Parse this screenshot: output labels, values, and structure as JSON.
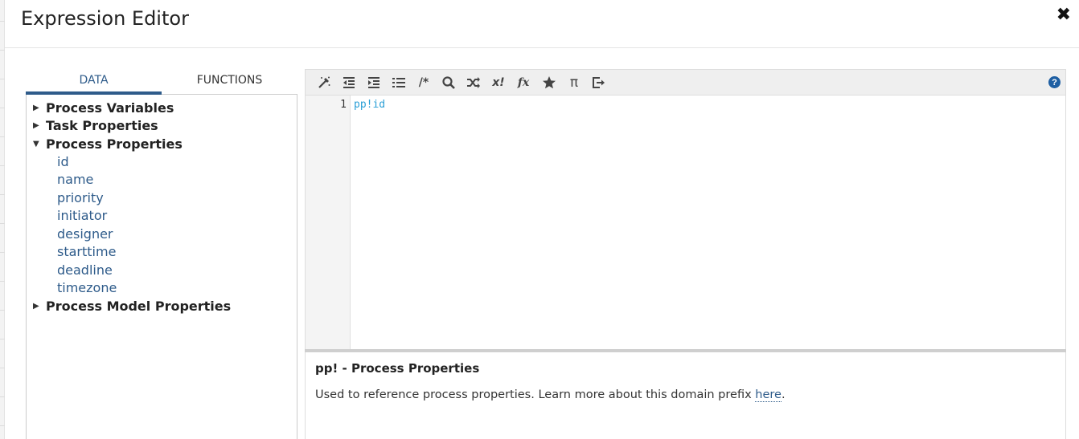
{
  "dialog": {
    "title": "Expression Editor",
    "close_label": "✖"
  },
  "left_panel": {
    "tabs": [
      {
        "label": "DATA",
        "active": true
      },
      {
        "label": "FUNCTIONS",
        "active": false
      }
    ],
    "tree": [
      {
        "label": "Process Variables",
        "expanded": false
      },
      {
        "label": "Task Properties",
        "expanded": false
      },
      {
        "label": "Process Properties",
        "expanded": true,
        "children": [
          "id",
          "name",
          "priority",
          "initiator",
          "designer",
          "starttime",
          "deadline",
          "timezone"
        ]
      },
      {
        "label": "Process Model Properties",
        "expanded": false
      }
    ]
  },
  "toolbar": {
    "buttons": [
      "magic-wand-icon",
      "outdent-icon",
      "indent-icon",
      "list-icon",
      "comment-icon",
      "search-icon",
      "shuffle-icon",
      "exclaim-icon",
      "function-icon",
      "star-icon",
      "pi-icon",
      "export-icon"
    ],
    "comment_text": "/*",
    "exclaim_text": "x!",
    "function_text": "fx",
    "pi_text": "π",
    "help_label": "?"
  },
  "editor": {
    "line_number": "1",
    "code": "pp!id"
  },
  "info": {
    "title": "pp! - Process Properties",
    "description_prefix": "Used to reference process properties. Learn more about this domain prefix ",
    "link_text": "here",
    "description_suffix": "."
  },
  "colors": {
    "accent": "#2e5b8a",
    "code": "#2a9fd6",
    "help": "#1e5fa3"
  }
}
